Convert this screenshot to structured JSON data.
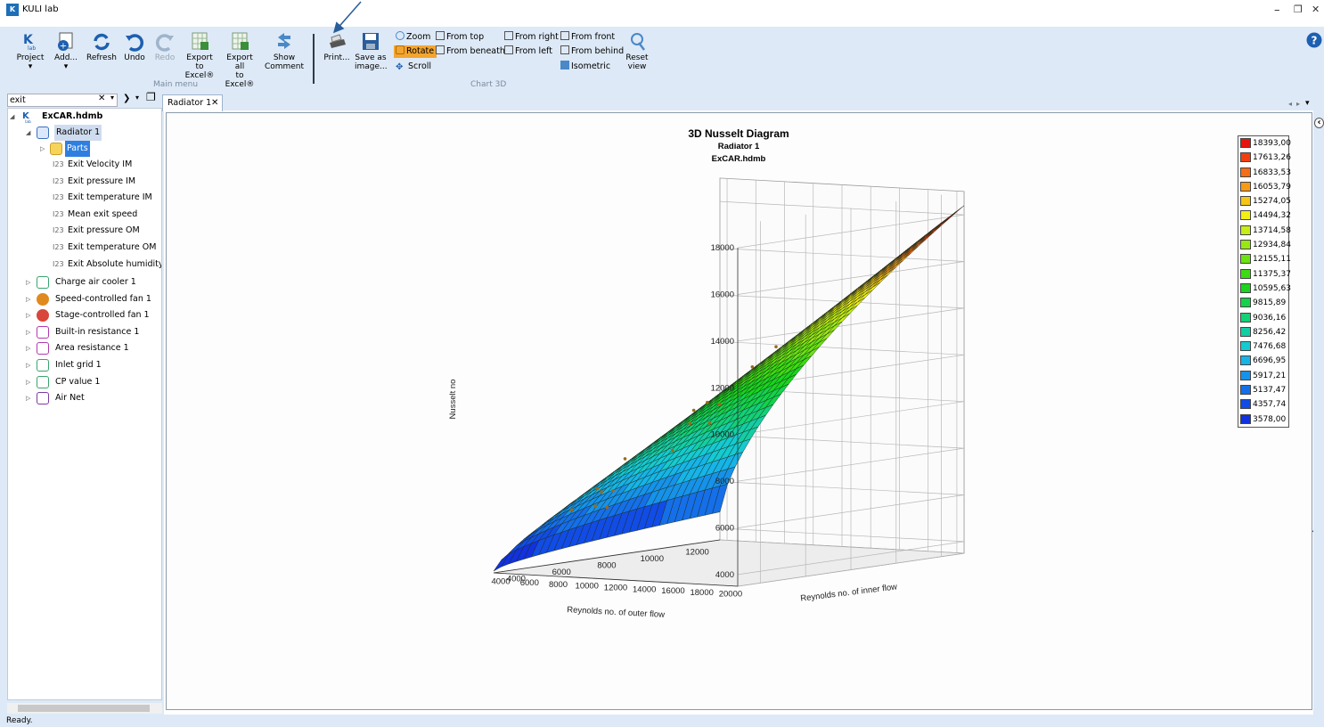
{
  "window": {
    "title": "KULI lab",
    "logo_text": "K",
    "minimize": "–",
    "restore": "❐",
    "close": "✕"
  },
  "ribbon": {
    "project": "Project",
    "add": "Add...",
    "refresh": "Refresh",
    "undo": "Undo",
    "redo": "Redo",
    "export_excel_1": "Export to",
    "export_excel_2": "Excel®",
    "export_all_1": "Export all",
    "export_all_2": "to Excel®",
    "show_comment_1": "Show",
    "show_comment_2": "Comment",
    "print": "Print...",
    "save_image_1": "Save as",
    "save_image_2": "image...",
    "zoom": "Zoom",
    "rotate": "Rotate",
    "scroll": "Scroll",
    "from_top": "From top",
    "from_beneath": "From beneath",
    "from_right": "From right",
    "from_left": "From left",
    "from_front": "From front",
    "from_behind": "From behind",
    "isometric": "Isometric",
    "reset_1": "Reset",
    "reset_2": "view",
    "group_main": "Main menu",
    "group_chart3d": "Chart 3D",
    "accent": "#f3a531"
  },
  "search": {
    "value": "exit",
    "clear": "✕",
    "dropdown": "▾",
    "next": "❯",
    "next_dropdown": "▾",
    "window": "❐"
  },
  "tree": {
    "root": "ExCAR.hdmb",
    "radiator": "Radiator 1",
    "parts": "Parts",
    "i23": "I23",
    "results": [
      "Exit Velocity IM",
      "Exit pressure IM",
      "Exit temperature IM",
      "Mean exit speed",
      "Exit pressure OM",
      "Exit temperature OM",
      "Exit Absolute humidity O"
    ],
    "components": [
      {
        "label": "Charge air cooler 1",
        "icon": "cooler-icon",
        "color": "#3aa36c"
      },
      {
        "label": "Speed-controlled fan 1",
        "icon": "fan-icon",
        "color": "#e08a1e"
      },
      {
        "label": "Stage-controlled fan 1",
        "icon": "fan-icon",
        "color": "#d9463a"
      },
      {
        "label": "Built-in resistance 1",
        "icon": "resistance-icon",
        "color": "#b03ab0"
      },
      {
        "label": "Area resistance 1",
        "icon": "area-resistance-icon",
        "color": "#b03ab0"
      },
      {
        "label": "Inlet grid 1",
        "icon": "grid-icon",
        "color": "#3aa36c"
      },
      {
        "label": "CP value 1",
        "icon": "cp-icon",
        "color": "#3aa36c"
      },
      {
        "label": "Air Net",
        "icon": "airnet-icon",
        "color": "#7c3a9e"
      }
    ]
  },
  "tab": {
    "label": "Radiator 1",
    "close": "✕"
  },
  "tabnav": {
    "left": "◂",
    "right": "▸",
    "menu": "▾",
    "collapse": "‹"
  },
  "chart_data": {
    "type": "surface",
    "title": "3D Nusselt Diagram",
    "subtitle1": "Radiator 1",
    "subtitle2": "ExCAR.hdmb",
    "xlabel": "Reynolds no. of outer flow",
    "zlabel": "Reynolds no. of inner flow",
    "ylabel": "Nusselt no",
    "x_ticks": [
      "20000",
      "18000",
      "16000",
      "14000",
      "12000",
      "10000",
      "8000",
      "6000",
      "4000"
    ],
    "z_ticks": [
      "4000",
      "6000",
      "8000",
      "10000",
      "12000"
    ],
    "y_ticks": [
      "18000",
      "16000",
      "14000",
      "12000",
      "10000",
      "8000",
      "6000",
      "4000"
    ],
    "xlim": [
      3500,
      20500
    ],
    "zlim": [
      3000,
      13000
    ],
    "ylim": [
      3500,
      19000
    ],
    "corners": {
      "max_x_max_z": 18393,
      "max_x_min_z": 9100,
      "min_x_max_z": 4700,
      "min_x_min_z": 3578
    },
    "legend": [
      "18393,00",
      "17613,26",
      "16833,53",
      "16053,79",
      "15274,05",
      "14494,32",
      "13714,58",
      "12934,84",
      "12155,11",
      "11375,37",
      "10595,63",
      "9815,89",
      "9036,16",
      "8256,42",
      "7476,68",
      "6696,95",
      "5917,21",
      "5137,47",
      "4357,74",
      "3578,00"
    ],
    "legend_colors": [
      "#e8140e",
      "#f04010",
      "#f76c15",
      "#f99a17",
      "#f5c616",
      "#f2ef14",
      "#c6ee14",
      "#98e912",
      "#6ae311",
      "#3ddc12",
      "#19d51e",
      "#12d34a",
      "#12d177",
      "#13cea4",
      "#15cad1",
      "#16b4e7",
      "#1692ea",
      "#156fe9",
      "#124ce6",
      "#1231df"
    ]
  },
  "status": "Ready."
}
